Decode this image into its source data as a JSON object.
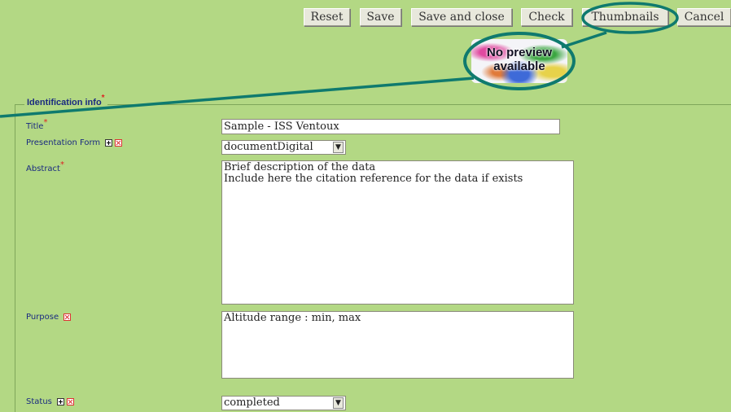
{
  "toolbar": {
    "reset_label": "Reset",
    "save_label": "Save",
    "save_close_label": "Save and close",
    "check_label": "Check",
    "thumbnails_label": "Thumbnails",
    "cancel_label": "Cancel"
  },
  "thumbnail": {
    "line1": "No preview",
    "line2": "available"
  },
  "section": {
    "title": "Identification info",
    "required_mark": "*"
  },
  "fields": {
    "title_label": "Title",
    "title_value": "Sample - ISS Ventoux",
    "presentation_label": "Presentation Form",
    "presentation_value": "documentDigital",
    "abstract_label": "Abstract",
    "abstract_value": "Brief description of the data\nInclude here the citation reference for the data if exists",
    "purpose_label": "Purpose",
    "purpose_value": "Altitude range : min, max",
    "status_label": "Status",
    "status_value": "completed"
  },
  "colors": {
    "background": "#b3d884",
    "annotation": "#0f7a6e",
    "label_text": "#1a2a80"
  }
}
